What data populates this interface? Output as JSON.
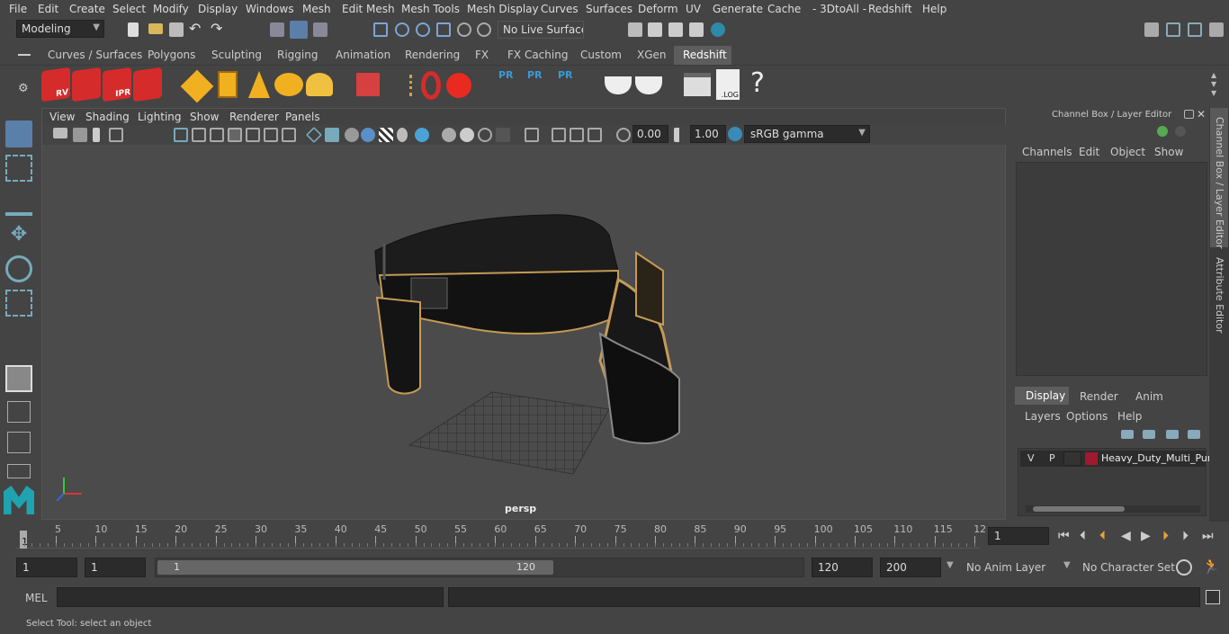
{
  "menubar": {
    "items": [
      "File",
      "Edit",
      "Create",
      "Select",
      "Modify",
      "Display",
      "Windows",
      "Mesh",
      "Edit Mesh",
      "Mesh Tools",
      "Mesh Display",
      "Curves",
      "Surfaces",
      "Deform",
      "UV",
      "Generate",
      "Cache",
      "- 3DtoAll -",
      "Redshift",
      "Help"
    ]
  },
  "status": {
    "mode": "Modeling",
    "live_surface": "No Live Surface"
  },
  "shelf": {
    "tabs": [
      "Curves / Surfaces",
      "Polygons",
      "Sculpting",
      "Rigging",
      "Animation",
      "Rendering",
      "FX",
      "FX Caching",
      "Custom",
      "XGen",
      "Redshift"
    ],
    "active": "Redshift",
    "rv": "RV",
    "ipr": "IPR",
    "pr": "PR",
    "log": ".LOG",
    "help": "?"
  },
  "viewport": {
    "menus": [
      "View",
      "Shading",
      "Lighting",
      "Show",
      "Renderer",
      "Panels"
    ],
    "exposure": "0.00",
    "gamma": "1.00",
    "colorspace": "sRGB gamma",
    "camera": "persp"
  },
  "channelbox": {
    "title": "Channel Box / Layer Editor",
    "menus": [
      "Channels",
      "Edit",
      "Object",
      "Show"
    ]
  },
  "layers": {
    "tabs": [
      "Display",
      "Render",
      "Anim"
    ],
    "menus": [
      "Layers",
      "Options",
      "Help"
    ],
    "row": {
      "v": "V",
      "p": "P",
      "name": "Heavy_Duty_Multi_Pur",
      "color": "#a0192e"
    }
  },
  "sidetabs": {
    "channel": "Channel Box / Layer Editor",
    "attr": "Attribute Editor"
  },
  "timeline": {
    "ticks": [
      "5",
      "10",
      "15",
      "20",
      "25",
      "30",
      "35",
      "40",
      "45",
      "50",
      "55",
      "60",
      "65",
      "70",
      "75",
      "80",
      "85",
      "90",
      "95",
      "100",
      "105",
      "110",
      "115",
      "12"
    ],
    "start_label": "1",
    "current": "1"
  },
  "range": {
    "start": "1",
    "current": "1",
    "slider_start": "1",
    "slider_end": "120",
    "end": "120",
    "max": "200",
    "anim_layer": "No Anim Layer",
    "char_set": "No Character Set"
  },
  "cmd": {
    "label": "MEL"
  },
  "help": {
    "text": "Select Tool: select an object"
  }
}
